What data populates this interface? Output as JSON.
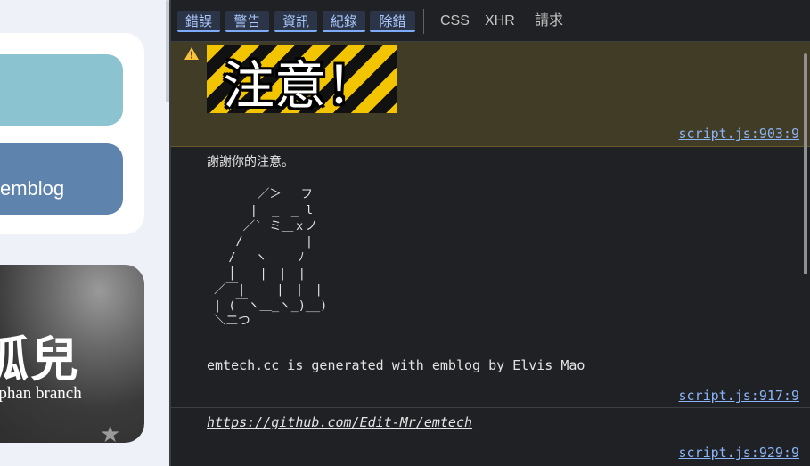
{
  "page": {
    "card_label": "emblog",
    "hero_title": "孤兒",
    "hero_subtitle": "rphan branch"
  },
  "toolbar": {
    "filters": [
      "錯誤",
      "警告",
      "資訊",
      "紀錄",
      "除錯"
    ],
    "types": [
      "CSS",
      "XHR",
      "請求"
    ]
  },
  "console": {
    "messages": [
      {
        "level": "warning",
        "banner_text": "注意！",
        "source": "script.js:903:9"
      },
      {
        "level": "log",
        "text": "謝謝你的注意。",
        "ascii_art": "       ／＞　 フ\n      |  _　_ l\n     ／` ミ＿ｘノ\n    /　　　 　 |\n   /　 ヽ　　 ﾉ\n   │　　|　|　|\n ／￣|　　 |　|　|\n | (￣ヽ＿_ヽ_)__)\n ＼二つ",
        "generated": "emtech.cc is generated with emblog by Elvis Mao",
        "source": "script.js:917:9"
      },
      {
        "level": "log",
        "link": "https://github.com/Edit-Mr/emtech",
        "source": "script.js:929:9"
      }
    ]
  },
  "colors": {
    "warning_bg": "#413c26",
    "link": "#8ab4f8",
    "filter_chip": "#2c3447"
  }
}
